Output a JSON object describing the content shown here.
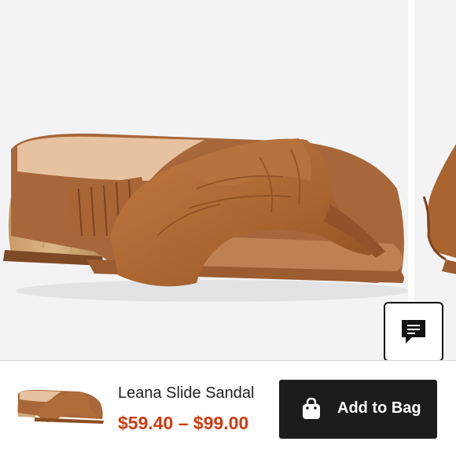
{
  "product": {
    "name": "Leana Slide Sandal",
    "price_range": "$59.40 – $99.00"
  },
  "actions": {
    "add_to_bag_label": "Add to Bag"
  },
  "icons": {
    "chat": "chat-bubble-icon",
    "bag": "shopping-bag-icon"
  },
  "colors": {
    "price": "#cf3b12",
    "button_bg": "#1c1c1c",
    "sandal_leather": "#b06d3c",
    "heel_wood": "#d2aa7a"
  }
}
